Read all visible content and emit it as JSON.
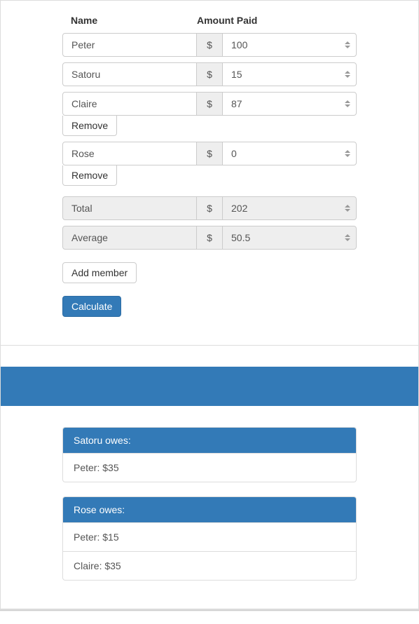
{
  "headers": {
    "name": "Name",
    "amount": "Amount Paid"
  },
  "currency_symbol": "$",
  "entries": [
    {
      "name": "Peter",
      "amount": "100",
      "removable": false
    },
    {
      "name": "Satoru",
      "amount": "15",
      "removable": false
    },
    {
      "name": "Claire",
      "amount": "87",
      "removable": true
    },
    {
      "name": "Rose",
      "amount": "0",
      "removable": true
    }
  ],
  "remove_label": "Remove",
  "summary": {
    "total_label": "Total",
    "total_value": "202",
    "average_label": "Average",
    "average_value": "50.5"
  },
  "add_member_label": "Add member",
  "calculate_label": "Calculate",
  "results": [
    {
      "title": "Satoru owes:",
      "items": [
        "Peter: $35"
      ]
    },
    {
      "title": "Rose owes:",
      "items": [
        "Peter: $15",
        "Claire: $35"
      ]
    }
  ]
}
